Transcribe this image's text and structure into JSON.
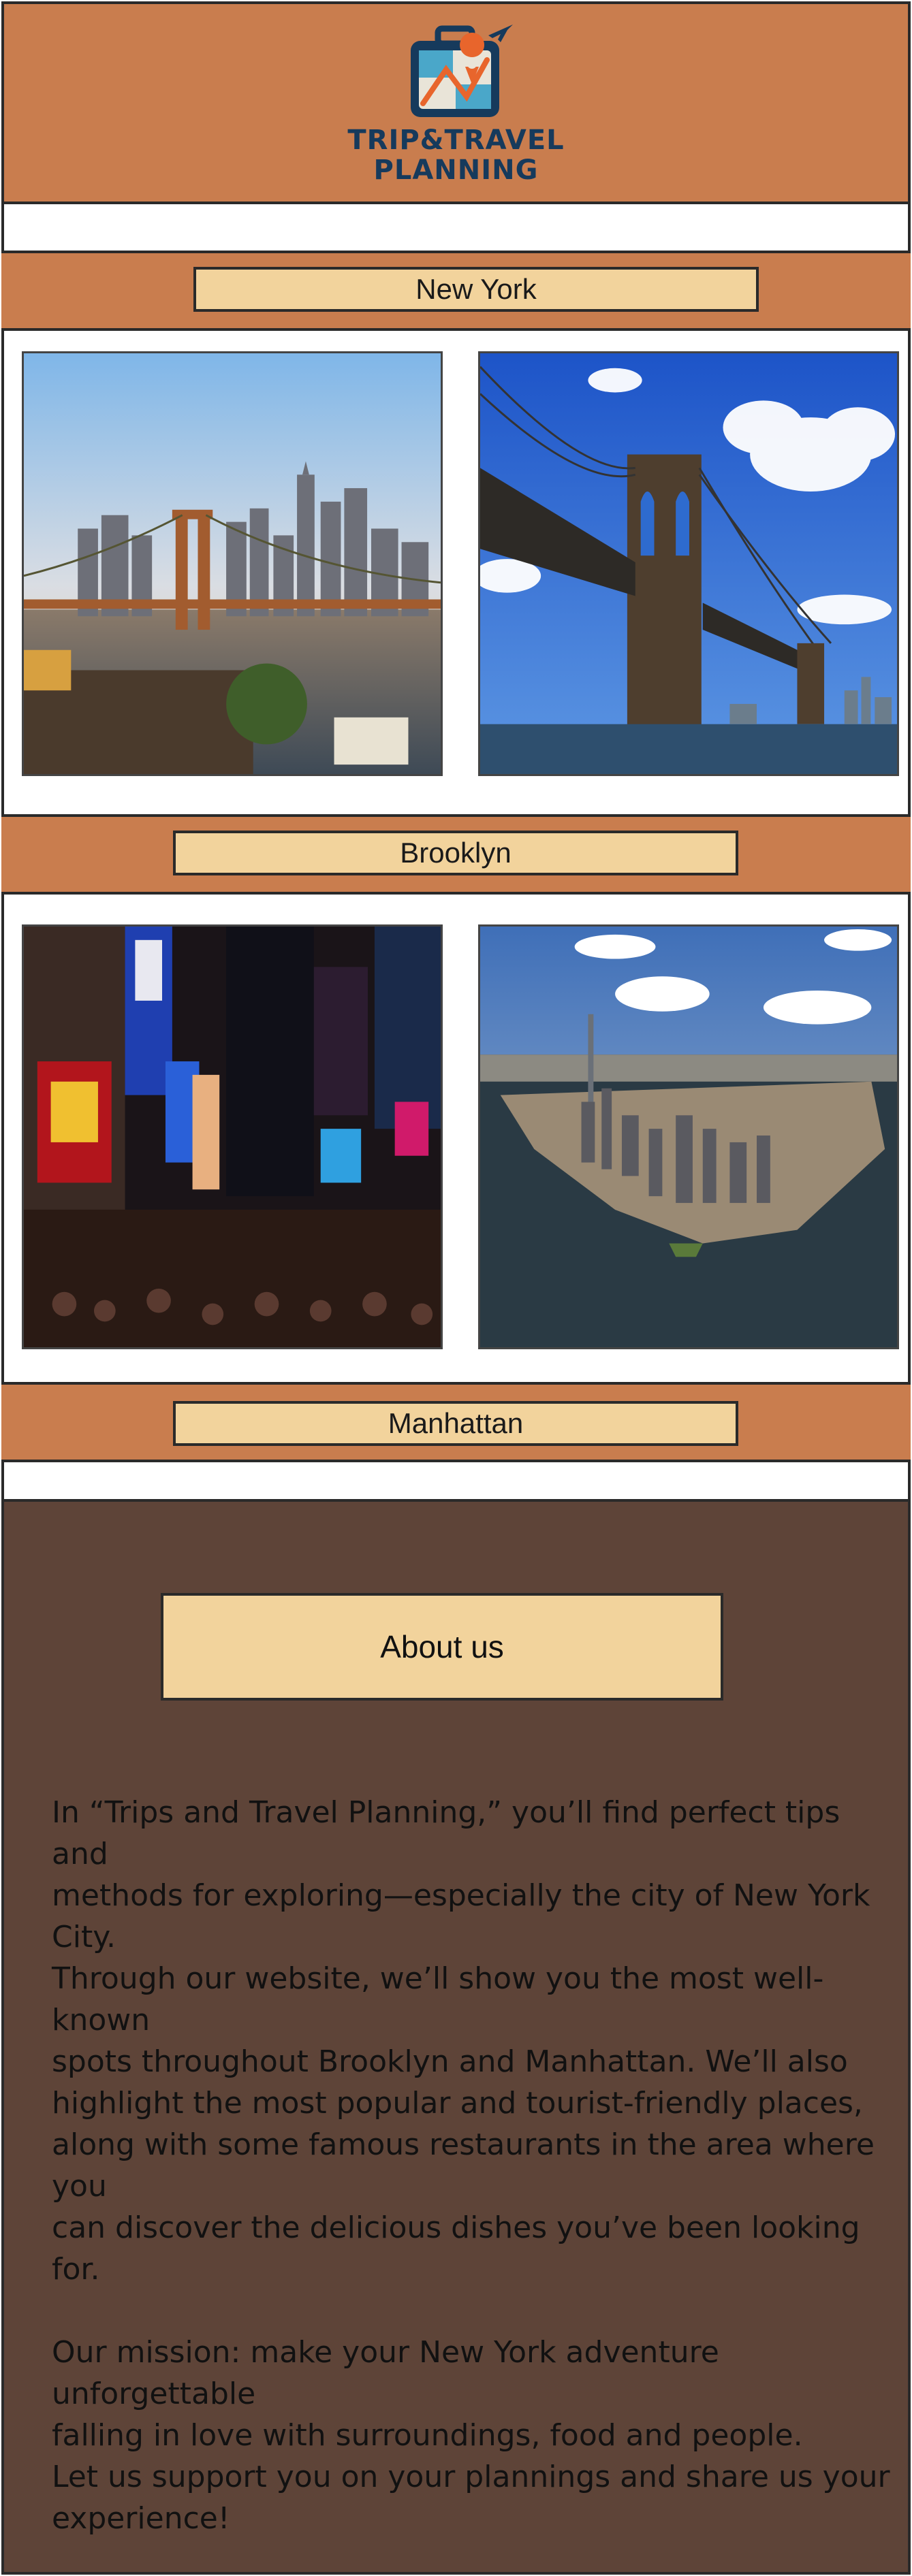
{
  "header": {
    "logo_line1": "TRIP&TRAVEL",
    "logo_line2": "PLANNING",
    "icon": "suitcase-plane-map-icon"
  },
  "sections": [
    {
      "label": "New York",
      "photos": [
        "manhattan-skyline-brooklyn-bridge-photo",
        "brooklyn-bridge-photo"
      ]
    },
    {
      "label": "Brooklyn",
      "photos": [
        "times-square-night-photo",
        "manhattan-aerial-photo"
      ]
    },
    {
      "label": "Manhattan"
    }
  ],
  "about": {
    "title": "About us",
    "paragraph1": [
      "In “Trips and Travel Planning,” you’ll find perfect tips and",
      "methods for exploring—especially the city of New York City.",
      "Through our website, we’ll show you the most well-known",
      "spots throughout Brooklyn and Manhattan. We’ll also",
      "highlight the most popular and tourist-friendly places,",
      "along with some famous restaurants in the area where you",
      "can discover the delicious dishes you’ve been looking for."
    ],
    "paragraph2": [
      "Our mission: make your New York adventure unforgettable",
      "falling in love with surroundings, food and  people.",
      "Let us support you on your plannings and share us your",
      "experience!"
    ]
  },
  "colors": {
    "header_bg": "#c97d4e",
    "label_bg": "#f2d39c",
    "about_bg": "#5e4438",
    "logo_navy": "#163a5c",
    "logo_orange": "#e8652c"
  }
}
